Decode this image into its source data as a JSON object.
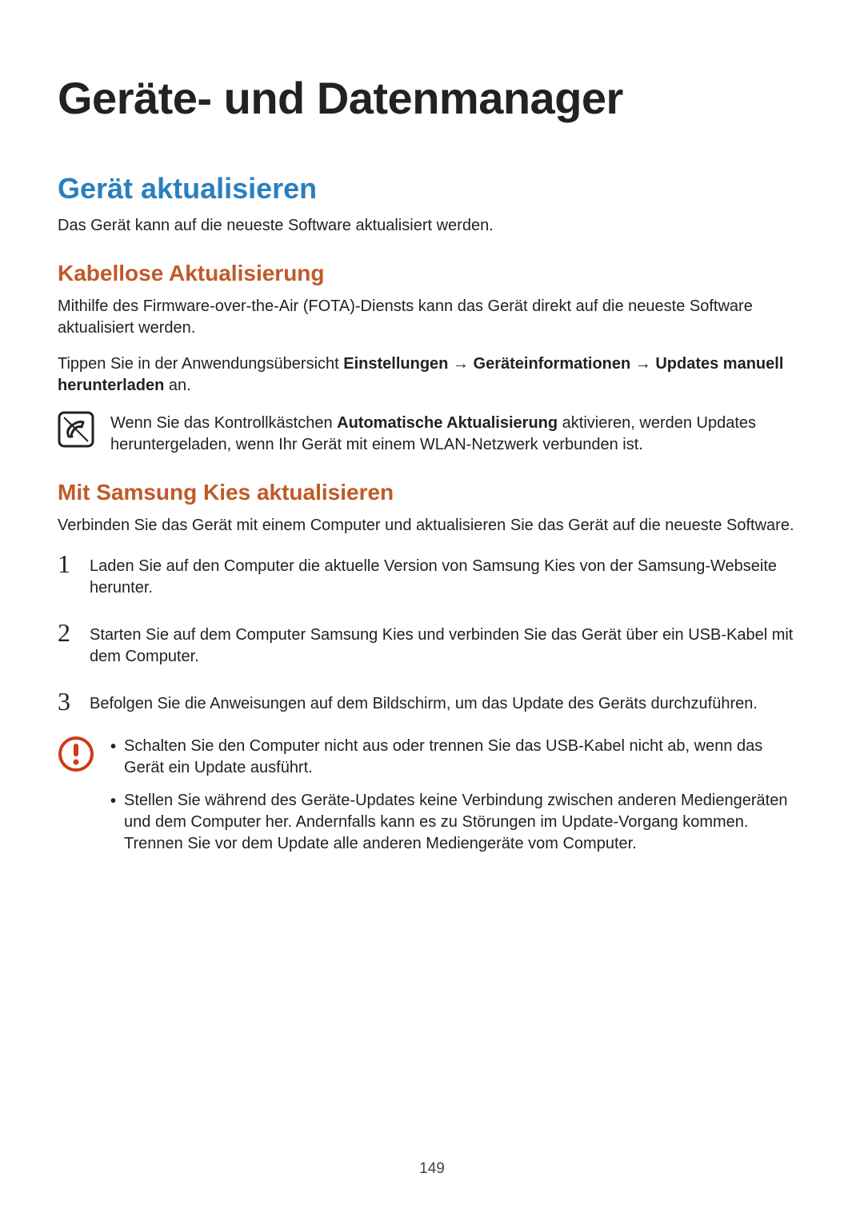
{
  "title": "Geräte- und Datenmanager",
  "section1": {
    "heading": "Gerät aktualisieren",
    "intro": "Das Gerät kann auf die neueste Software aktualisiert werden."
  },
  "sub1": {
    "heading": "Kabellose Aktualisierung",
    "p1": "Mithilfe des Firmware-over-the-Air (FOTA)-Diensts kann das Gerät direkt auf die neueste Software aktualisiert werden.",
    "p2_pre": "Tippen Sie in der Anwendungsübersicht ",
    "p2_b1": "Einstellungen",
    "p2_arrow1": " → ",
    "p2_b2": "Geräteinformationen",
    "p2_arrow2": " → ",
    "p2_b3": "Updates manuell herunterladen",
    "p2_post": " an.",
    "note_pre": "Wenn Sie das Kontrollkästchen ",
    "note_b": "Automatische Aktualisierung",
    "note_post": " aktivieren, werden Updates heruntergeladen, wenn Ihr Gerät mit einem WLAN-Netzwerk verbunden ist."
  },
  "sub2": {
    "heading": "Mit Samsung Kies aktualisieren",
    "intro": "Verbinden Sie das Gerät mit einem Computer und aktualisieren Sie das Gerät auf die neueste Software.",
    "steps": [
      "Laden Sie auf den Computer die aktuelle Version von Samsung Kies von der Samsung-Webseite herunter.",
      "Starten Sie auf dem Computer Samsung Kies und verbinden Sie das Gerät über ein USB-Kabel mit dem Computer.",
      "Befolgen Sie die Anweisungen auf dem Bildschirm, um das Update des Geräts durchzuführen."
    ],
    "warnings": [
      "Schalten Sie den Computer nicht aus oder trennen Sie das USB-Kabel nicht ab, wenn das Gerät ein Update ausführt.",
      "Stellen Sie während des Geräte-Updates keine Verbindung zwischen anderen Mediengeräten und dem Computer her. Andernfalls kann es zu Störungen im Update-Vorgang kommen. Trennen Sie vor dem Update alle anderen Mediengeräte vom Computer."
    ]
  },
  "pageNumber": "149",
  "nums": {
    "n1": "1",
    "n2": "2",
    "n3": "3"
  }
}
